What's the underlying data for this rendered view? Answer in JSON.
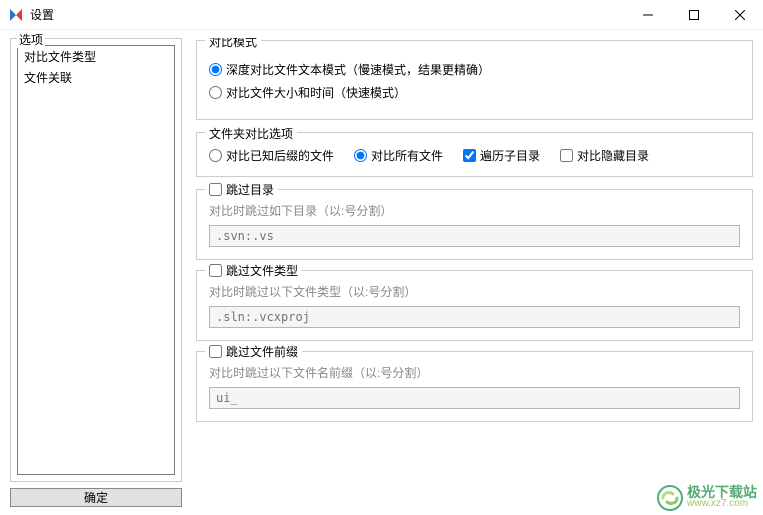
{
  "titlebar": {
    "title": "设置"
  },
  "sidebar": {
    "legend": "选项",
    "items": [
      "对比文件类型",
      "文件关联"
    ],
    "ok_label": "确定"
  },
  "compare_mode": {
    "title": "对比模式",
    "deep_label": "深度对比文件文本模式（慢速模式，结果更精确）",
    "fast_label": "对比文件大小和时间（快速模式）"
  },
  "folder_opts": {
    "title": "文件夹对比选项",
    "known_ext_label": "对比已知后缀的文件",
    "all_files_label": "对比所有文件",
    "recurse_label": "遍历子目录",
    "hidden_label": "对比隐藏目录"
  },
  "skip_dir": {
    "title": "跳过目录",
    "hint": "对比时跳过如下目录（以:号分割）",
    "placeholder": ".svn:.vs"
  },
  "skip_type": {
    "title": "跳过文件类型",
    "hint": "对比时跳过以下文件类型（以:号分割）",
    "placeholder": ".sln:.vcxproj"
  },
  "skip_prefix": {
    "title": "跳过文件前缀",
    "hint": "对比时跳过以下文件名前缀（以:号分割）",
    "placeholder": "ui_"
  },
  "watermark": {
    "cn": "极光下载站",
    "url": "www.xz7.com"
  }
}
